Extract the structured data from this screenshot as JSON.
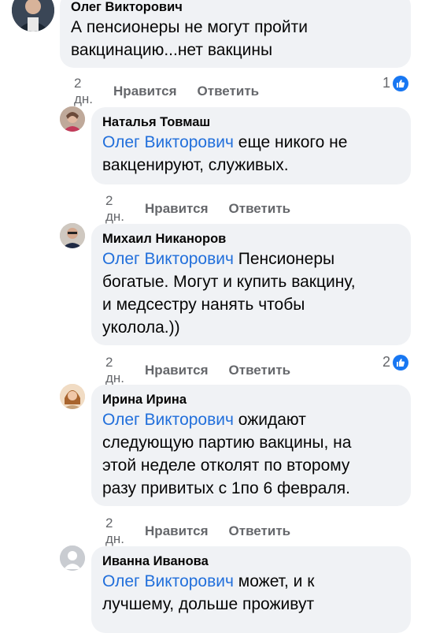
{
  "comments": [
    {
      "author": "Олег Викторович",
      "mention": "",
      "text_lines": [
        "А пенсионеры не могут пройти",
        "вакцинацию...нет вакцины"
      ],
      "time": "2 дн.",
      "like_label": "Нравится",
      "reply_label": "Ответить",
      "reactions": "1"
    },
    {
      "author": "Наталья Товмаш",
      "mention": "Олег Викторович",
      "text_lines": [
        " еще никого не",
        "вакценируют, служивых."
      ],
      "time": "2 дн.",
      "like_label": "Нравится",
      "reply_label": "Ответить",
      "reactions": ""
    },
    {
      "author": "Михаил Никаноров",
      "mention": "Олег Викторович",
      "text_lines": [
        " Пенсионеры",
        "богатые. Могут и купить вакцину,",
        "и медсестру нанять чтобы",
        "уколола.))"
      ],
      "time": "2 дн.",
      "like_label": "Нравится",
      "reply_label": "Ответить",
      "reactions": "2"
    },
    {
      "author": "Ирина Ирина",
      "mention": "Олег Викторович",
      "text_lines": [
        " ожидают",
        "следующую партию вакцины, на",
        "этой неделе отколят по второму",
        "разу привитых с 1по 6 февраля."
      ],
      "time": "2 дн.",
      "like_label": "Нравится",
      "reply_label": "Ответить",
      "reactions": ""
    },
    {
      "author": "Иванна Иванова",
      "mention": "Олег Викторович",
      "text_lines": [
        " может, и к",
        "лучшему, дольше проживут"
      ],
      "time": "",
      "like_label": "",
      "reply_label": "",
      "reactions": ""
    }
  ],
  "colors": {
    "mention": "#216fdb",
    "bubble": "#f0f2f5",
    "like": "#1877f2",
    "meta": "#65676b"
  },
  "icons": {
    "like": "thumbs-up-icon",
    "default_avatar": "person-silhouette-icon"
  }
}
